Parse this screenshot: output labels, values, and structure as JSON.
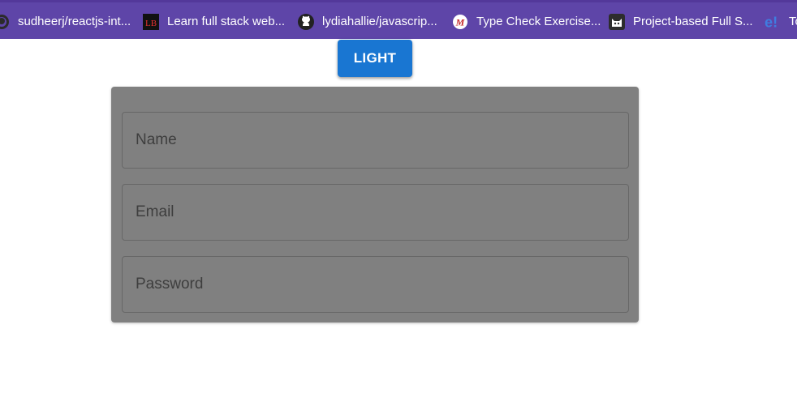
{
  "bookmarks": [
    {
      "label": "sudheerj/reactjs-int...",
      "icon": "github-icon"
    },
    {
      "label": "Learn full stack web...",
      "icon": "lb-logo-icon"
    },
    {
      "label": "lydiahallie/javascrip...",
      "icon": "github-icon"
    },
    {
      "label": "Type Check Exercise...",
      "icon": "m-logo-icon"
    },
    {
      "label": "Project-based Full S...",
      "icon": "cat-logo-icon"
    },
    {
      "label": "To",
      "icon": "e-logo-icon"
    }
  ],
  "theme_toggle": {
    "label": "LIGHT"
  },
  "form": {
    "name_placeholder": "Name",
    "email_placeholder": "Email",
    "password_placeholder": "Password"
  },
  "colors": {
    "bookmarks_bar": "#5e45a8",
    "button": "#1976d2",
    "card": "#808080"
  }
}
